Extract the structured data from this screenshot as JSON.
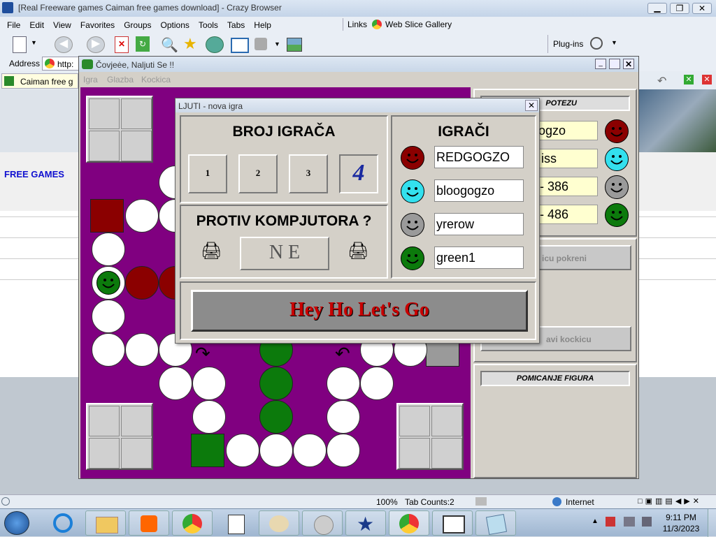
{
  "browser": {
    "title": "[Real Freeware games Caiman free games download] - Crazy Browser",
    "menu": [
      "File",
      "Edit",
      "View",
      "Favorites",
      "Groups",
      "Options",
      "Tools",
      "Tabs",
      "Help"
    ],
    "links_label": "Links",
    "web_slice": "Web Slice Gallery",
    "plugins_label": "Plug-ins",
    "address_label": "Address",
    "address_value": "http:",
    "tab_label": "Caiman free g",
    "page_link": "FREE GAMES",
    "status_zoom": "100%",
    "status_tabs": "Tab Counts:2",
    "status_zone": "Internet"
  },
  "game_window": {
    "title": "Čovjeėe, Naljuti Se !!",
    "menu": [
      "Igra",
      "Glazba",
      "Kockica"
    ],
    "side": {
      "turn_header": "POTEZU",
      "players": [
        "ogzo",
        "iss",
        "- 386",
        "- 486"
      ],
      "roll_button": "icu pokreni",
      "stop_button": "avi kockicu",
      "moves_header": "POMICANJE FIGURA"
    }
  },
  "dialog": {
    "title": "LJUTI - nova igra",
    "count_header": "BROJ IGRAČA",
    "count_buttons": [
      "1",
      "2",
      "3",
      "4"
    ],
    "vs_header": "PROTIV KOMPJUTORA ?",
    "vs_value": "N E",
    "players_header": "IGRAČI",
    "players": [
      "REDGOGZO",
      "bloogogzo",
      "yrerow",
      "green1"
    ],
    "go_button": "Hey Ho Let's Go"
  },
  "taskbar": {
    "time": "9:11 PM",
    "date": "11/3/2023"
  },
  "colors": {
    "board": "#800080",
    "red": "#8b0000",
    "cyan": "#33e0ee",
    "gray": "#9a9a9a",
    "green": "#0c7a0c"
  }
}
